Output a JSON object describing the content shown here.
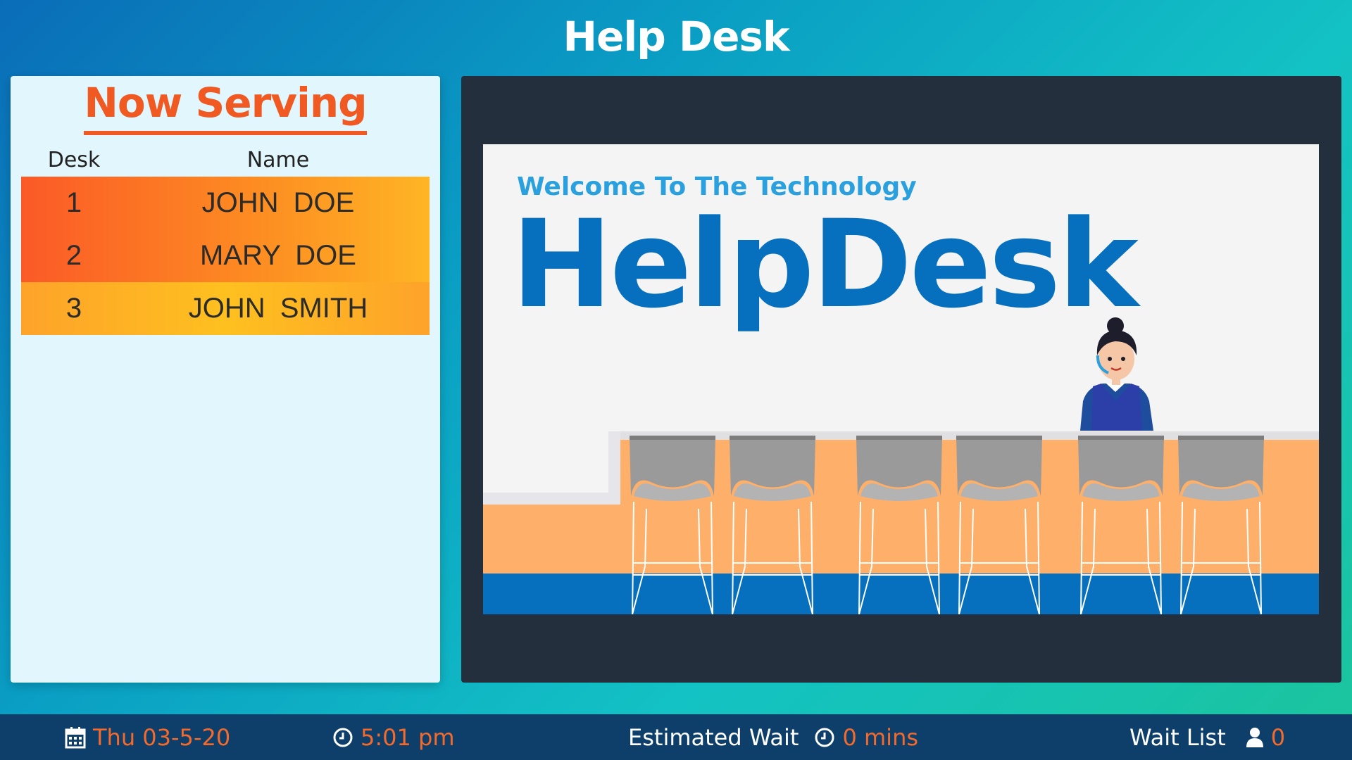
{
  "header": {
    "title": "Help Desk"
  },
  "now_serving": {
    "title": "Now Serving",
    "columns": [
      "Desk",
      "Name"
    ],
    "rows": [
      {
        "desk": "1",
        "name": "JOHN  DOE"
      },
      {
        "desk": "2",
        "name": "MARY  DOE"
      },
      {
        "desk": "3",
        "name": "JOHN  SMITH"
      }
    ]
  },
  "media": {
    "welcome": "Welcome To The Technology",
    "brand": "HelpDesk",
    "chair_count": 6
  },
  "footer": {
    "date": "Thu 03-5-20",
    "time": "5:01 pm",
    "wait_label": "Estimated Wait",
    "wait_value": "0 mins",
    "waitlist_label": "Wait List",
    "waitlist_value": "0"
  },
  "colors": {
    "accent": "#f05a22",
    "brand_blue": "#0670bf",
    "footer_bg": "#0d3f6a"
  },
  "icons": {
    "date": "calendar-icon",
    "time": "clock-icon",
    "wait": "clock-icon",
    "waitlist": "user-icon"
  }
}
